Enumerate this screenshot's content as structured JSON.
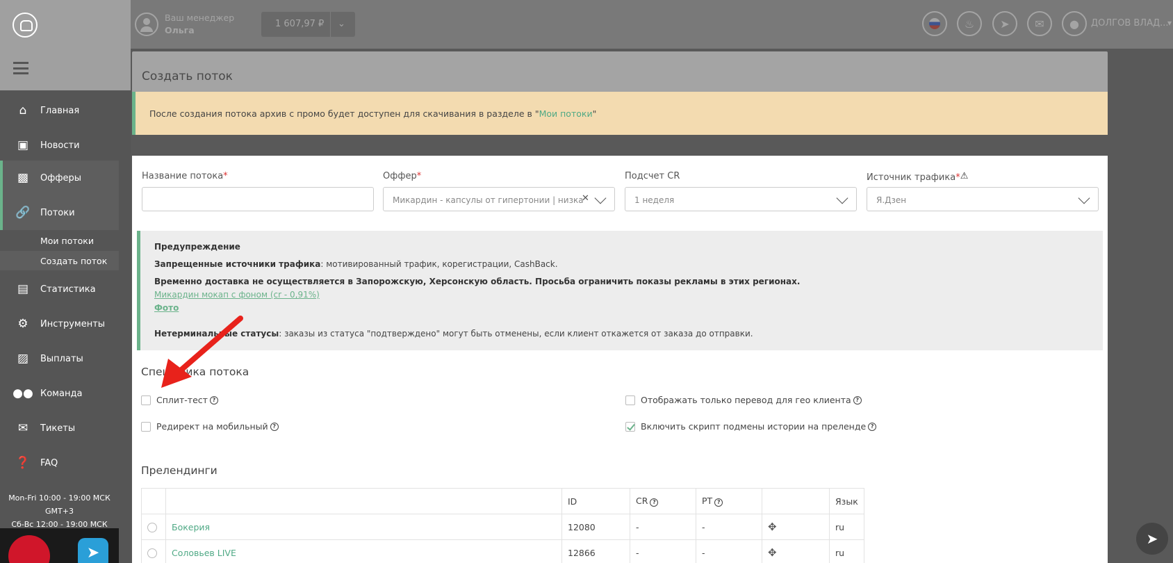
{
  "header": {
    "manager_label": "Ваш менеджер",
    "manager_name": "Ольга",
    "balance": "1 607,97 ₽",
    "user_name": "ДОЛГОВ ВЛАД..."
  },
  "sidebar": {
    "items": [
      {
        "label": "Главная",
        "icon": "home-icon"
      },
      {
        "label": "Новости",
        "icon": "news-icon"
      },
      {
        "label": "Офферы",
        "icon": "briefcase-icon"
      },
      {
        "label": "Потоки",
        "icon": "link-icon"
      },
      {
        "label": "Статистика",
        "icon": "chart-icon"
      },
      {
        "label": "Инструменты",
        "icon": "gear-icon"
      },
      {
        "label": "Выплаты",
        "icon": "wallet-icon"
      },
      {
        "label": "Команда",
        "icon": "team-icon"
      },
      {
        "label": "Тикеты",
        "icon": "mail-icon"
      },
      {
        "label": "FAQ",
        "icon": "question-icon"
      }
    ],
    "subitems": [
      "Мои потоки",
      "Создать поток"
    ],
    "hours_weekdays": "Mon-Fri 10:00 - 19:00 МСК GMT+3",
    "hours_weekend": "Сб-Вс 12:00 - 19:00 МСК"
  },
  "page": {
    "title": "Создать поток",
    "banner_text": "После создания потока архив с промо будет доступен для скачивания в разделе в \"",
    "banner_link": "Мои потоки",
    "banner_end": "\""
  },
  "form": {
    "name_label": "Название потока",
    "name_value": "",
    "offer_label": "Оффер",
    "offer_value": "Микардин - капсулы от гипертонии | низкая...",
    "cr_label": "Подсчет CR",
    "cr_value": "1 неделя",
    "source_label": "Источник трафика",
    "source_value": "Я.Дзен",
    "required_mark": "*"
  },
  "notice": {
    "title": "Предупреждение",
    "forbidden_label": "Запрещенные источники трафика",
    "forbidden_text": ": мотивированный трафик, корегистрации, CashBack.",
    "delivery": "Временно доставка не осуществляется в Запорожскую, Херсонскую область. Просьба ограничить показы рекламы в этих регионах.",
    "link1": "Микардин мокап с фоном (cr - 0,91%)",
    "link2": "Фото",
    "statuses_label": "Нетерминальные статусы",
    "statuses_text": ": заказы из статуса \"подтверждено\" могут быть отменены, если клиент откажется от заказа до отправки."
  },
  "specifics": {
    "title": "Специфика потока",
    "options": [
      {
        "label": "Сплит-тест",
        "checked": false
      },
      {
        "label": "Редирект на мобильный",
        "checked": false
      },
      {
        "label": "Отображать только перевод для гео клиента",
        "checked": false
      },
      {
        "label": "Включить скрипт подмены истории на преленде",
        "checked": true
      }
    ]
  },
  "prelandings": {
    "title": "Прелендинги",
    "columns": [
      "",
      "",
      "ID",
      "CR",
      "PT",
      "",
      "Язык"
    ],
    "rows": [
      {
        "name": "Бокерия",
        "id": "12080",
        "cr": "-",
        "pt": "-",
        "lang": "ru"
      },
      {
        "name": "Соловьев LIVE",
        "id": "12866",
        "cr": "-",
        "pt": "-",
        "lang": "ru"
      }
    ]
  },
  "colors": {
    "accent": "#6bb38b",
    "banner": "#f3dbb0",
    "arrow": "#e8221b"
  }
}
